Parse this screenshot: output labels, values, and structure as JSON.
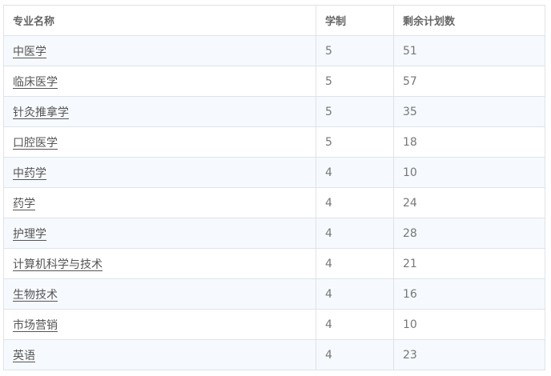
{
  "table": {
    "headers": [
      "专业名称",
      "学制",
      "剩余计划数"
    ],
    "rows": [
      {
        "name": "中医学",
        "years": "5",
        "remaining": "51"
      },
      {
        "name": "临床医学",
        "years": "5",
        "remaining": "57"
      },
      {
        "name": "针灸推拿学",
        "years": "5",
        "remaining": "35"
      },
      {
        "name": "口腔医学",
        "years": "5",
        "remaining": "18"
      },
      {
        "name": "中药学",
        "years": "4",
        "remaining": "10"
      },
      {
        "name": "药学",
        "years": "4",
        "remaining": "24"
      },
      {
        "name": "护理学",
        "years": "4",
        "remaining": "28"
      },
      {
        "name": "计算机科学与技术",
        "years": "4",
        "remaining": "21"
      },
      {
        "name": "生物技术",
        "years": "4",
        "remaining": "16"
      },
      {
        "name": "市场营销",
        "years": "4",
        "remaining": "10"
      },
      {
        "name": "英语",
        "years": "4",
        "remaining": "23"
      }
    ]
  },
  "colors": {
    "border": "#dfe3e8",
    "stripe": "#f6f9fd",
    "text": "#666666"
  }
}
